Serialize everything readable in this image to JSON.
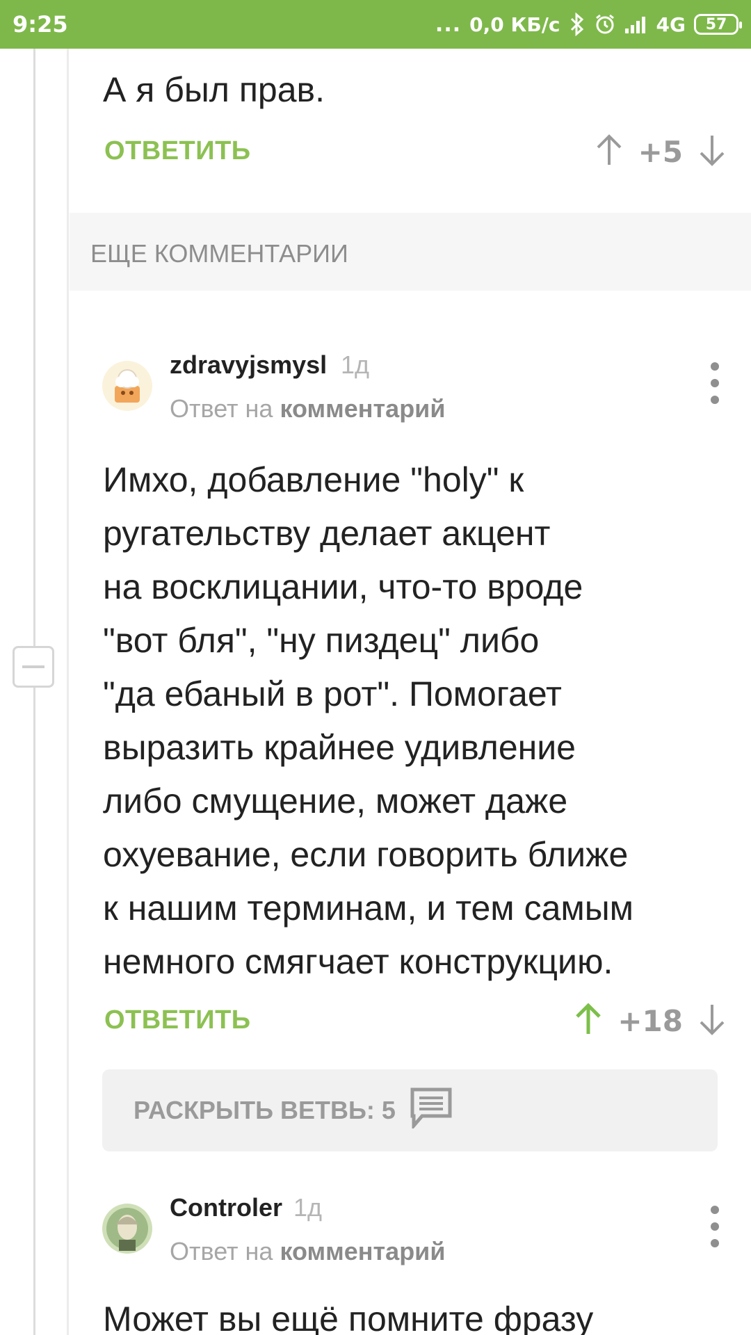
{
  "status_bar": {
    "time": "9:25",
    "dots": "...",
    "network_speed": "0,0 КБ/с",
    "network_type": "4G",
    "battery": "57",
    "icons": [
      "bluetooth-icon",
      "alarm-icon",
      "signal-icon",
      "battery-icon"
    ],
    "bg_color": "#7eb84a"
  },
  "previous_comment": {
    "text": "А я был прав.",
    "reply_label": "ОТВЕТИТЬ",
    "score": "+5"
  },
  "more_comments_label": "ЕЩЕ КОММЕНТАРИИ",
  "comments": [
    {
      "username": "zdravyjsmysl",
      "time": "1д",
      "reply_prefix": "Ответ на",
      "reply_target": "комментарий",
      "body_lines": [
        "Имхо, добавление \"holy\" к",
        "ругательству делает акцент",
        "на восклицании, что-то вроде",
        "\"вот бля\", \"ну пиздец\" либо",
        "\"да ебаный в рот\". Помогает",
        "выразить крайнее удивление",
        "либо смущение, может даже",
        "охуевание, если говорить ближе",
        "к нашим терминам, и тем самым",
        "немного смягчает конструкцию."
      ],
      "reply_label": "ОТВЕТИТЬ",
      "score": "+18",
      "upvoted": true,
      "expand_label": "РАСКРЫТЬ ВЕТВЬ: 5"
    },
    {
      "username": "Controler",
      "time": "1д",
      "reply_prefix": "Ответ на",
      "reply_target": "комментарий",
      "body_start": "Может вы ещё помните фразу"
    }
  ],
  "colors": {
    "accent_green": "#8cc152",
    "upvote_active": "#7cbf4a",
    "muted": "#9a9a9a"
  }
}
